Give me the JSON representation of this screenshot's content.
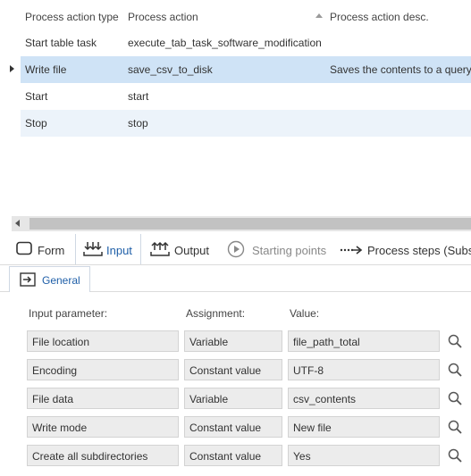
{
  "grid": {
    "headers": {
      "type": "Process action type",
      "action": "Process action",
      "desc": "Process action desc."
    },
    "rows": [
      {
        "type": "Start table task",
        "action": "execute_tab_task_software_modification",
        "desc": ""
      },
      {
        "type": "Write file",
        "action": "save_csv_to_disk",
        "desc": "Saves the contents to a query,"
      },
      {
        "type": "Start",
        "action": "start",
        "desc": ""
      },
      {
        "type": "Stop",
        "action": "stop",
        "desc": ""
      }
    ]
  },
  "tabs": {
    "form": "Form",
    "input": "Input",
    "output": "Output",
    "starting_points": "Starting points",
    "process_steps": "Process steps (Subseq"
  },
  "subtab": {
    "general": "General"
  },
  "params": {
    "col_param": "Input parameter:",
    "col_assign": "Assignment:",
    "col_value": "Value:",
    "rows": [
      {
        "param": "File location",
        "assign": "Variable",
        "value": "file_path_total"
      },
      {
        "param": "Encoding",
        "assign": "Constant value",
        "value": "UTF-8"
      },
      {
        "param": "File data",
        "assign": "Variable",
        "value": "csv_contents"
      },
      {
        "param": "Write mode",
        "assign": "Constant value",
        "value": "New file"
      },
      {
        "param": "Create all subdirectories",
        "assign": "Constant value",
        "value": "Yes"
      }
    ]
  },
  "icons": {
    "form": "form-icon",
    "input": "input-icon",
    "output": "output-icon",
    "starting_points": "play-circle-icon",
    "process_steps": "dotted-arrow-icon",
    "general": "enter-box-icon",
    "search": "search-icon"
  },
  "colors": {
    "accent": "#1f5fa8",
    "selected_row": "#cfe3f6",
    "alt_row": "#ecf3fa"
  }
}
